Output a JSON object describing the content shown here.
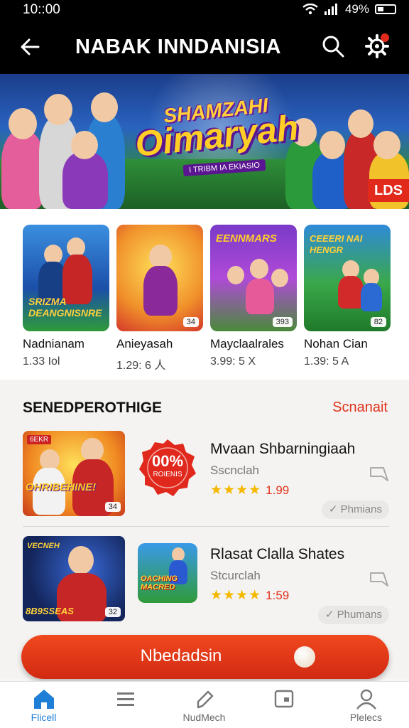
{
  "status_bar": {
    "time": "10::00",
    "battery": "49%"
  },
  "app_bar": {
    "title": "NABAK INNDANISIA"
  },
  "hero": {
    "title_line1": "SHAMZAHI",
    "title_line2": "Oimaryah",
    "subtitle": "I TRIBM IA EKIASIO",
    "badge": "LDS"
  },
  "featured": [
    {
      "name": "Nadnianam",
      "meta": "1.33 Iol",
      "art_text": "SRIZMA DEANGNISNRE",
      "label": ""
    },
    {
      "name": "Anieyasah",
      "meta": "1.29: 6 人",
      "art_text": "",
      "label": "34"
    },
    {
      "name": "Mayclaalrales",
      "meta": "3.99: 5 X",
      "art_text": "EENNMARS",
      "label": "393"
    },
    {
      "name": "Nohan Cian",
      "meta": "1.39: 5 A",
      "art_text": "CEEERI NAI HENGR",
      "label": "82"
    }
  ],
  "list_section": {
    "title": "SENEDPEROTHIGE",
    "link": "Scnanait",
    "items": [
      {
        "thumb_tag": "6EKR",
        "thumb_text": "OHRIBEHINE!",
        "thumb_num": "34",
        "badge_text": "00%",
        "badge_sub": "ROIENIS",
        "title": "Mvaan Shbarningiaah",
        "subtitle": "Sscnclah",
        "stars": "★★★★",
        "rating": "1.99",
        "pill": "✓ Phmians"
      },
      {
        "thumb_tag": "VECNEH",
        "thumb_text": "8B9SSEAS",
        "thumb_num": "32",
        "icon_text": "OACHING MACRED",
        "title": "Rlasat Clalla Shates",
        "subtitle": "Stcurclah",
        "stars": "★★★★",
        "rating": "1:59",
        "pill": "✓ Phumans"
      }
    ]
  },
  "cta": {
    "label": "Nbedadsin"
  },
  "bottom_nav": [
    {
      "label": "Flicell",
      "icon": "home-icon",
      "active": true
    },
    {
      "label": "",
      "icon": "menu-icon",
      "active": false
    },
    {
      "label": "NudMech",
      "icon": "edit-icon",
      "active": false
    },
    {
      "label": "",
      "icon": "tablet-icon",
      "active": false
    },
    {
      "label": "Plelecs",
      "icon": "profile-icon",
      "active": false
    }
  ],
  "colors": {
    "accent": "#e0321c",
    "nav_active": "#1f7fd6",
    "star": "#f5b800"
  }
}
